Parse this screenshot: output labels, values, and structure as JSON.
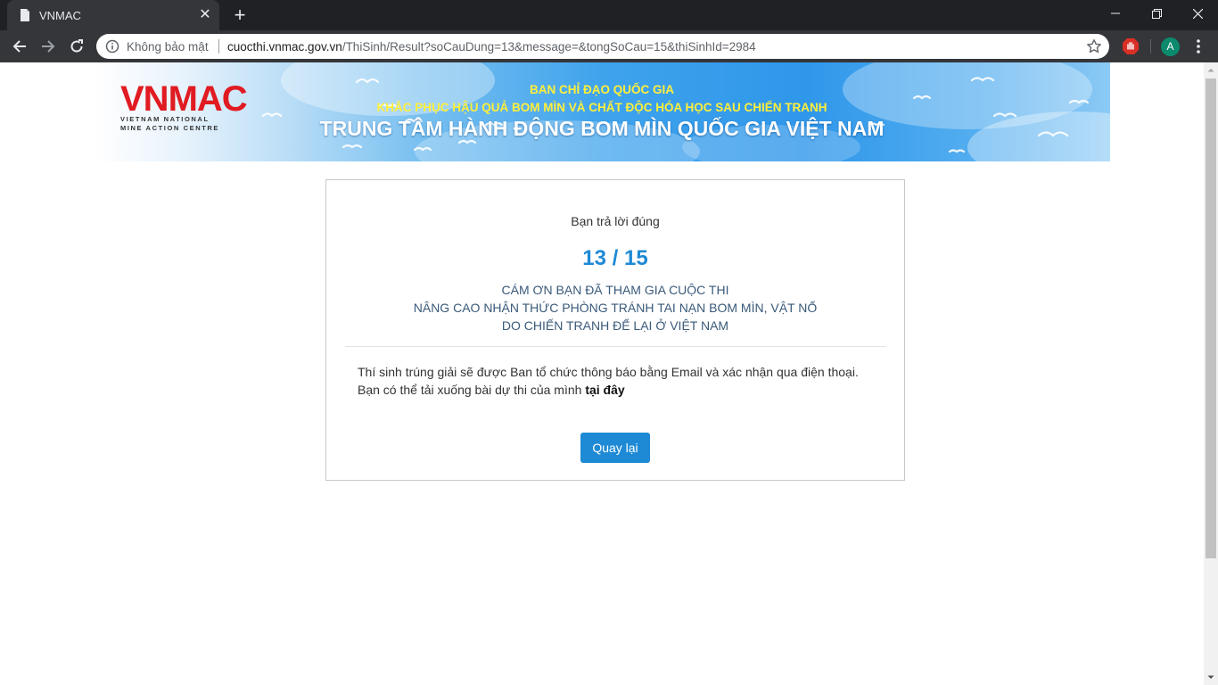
{
  "browser": {
    "tab_title": "VNMAC",
    "security_label": "Không bảo mật",
    "url_host": "cuocthi.vnmac.gov.vn",
    "url_path": "/ThiSinh/Result?soCauDung=13&message=&tongSoCau=15&thiSinhId=2984",
    "avatar_letter": "A"
  },
  "banner": {
    "logo_text": "VNMAC",
    "logo_sub_line1": "VIETNAM NATIONAL",
    "logo_sub_line2": "MINE ACTION CENTRE",
    "line1": "BAN CHỈ ĐẠO QUỐC GIA",
    "line2": "KHẮC PHỤC HẬU QUẢ BOM MÌN VÀ CHẤT ĐỘC HÓA HỌC SAU CHIẾN TRANH",
    "line3": "TRUNG TÂM HÀNH ĐỘNG BOM MÌN QUỐC GIA VIỆT NAM"
  },
  "result": {
    "answered_label": "Bạn trả lời đúng",
    "score": "13 / 15",
    "thanks_line1": "CÁM ƠN BẠN ĐÃ THAM GIA CUỘC THI",
    "thanks_line2": "NÂNG CAO NHẬN THỨC PHÒNG TRÁNH TAI NẠN BOM MÌN, VẬT NỔ",
    "thanks_line3": "DO CHIẾN TRANH ĐỂ LẠI Ở VIỆT NAM",
    "notice_line1": "Thí sinh trúng giải sẽ được Ban tổ chức thông báo bằng Email và xác nhận qua điện thoại.",
    "notice_line2_prefix": "Bạn có thể tải xuống bài dự thi của mình ",
    "download_link": "tại đây",
    "back_button": "Quay lại"
  },
  "colors": {
    "accent": "#1e8ad6",
    "logo_red": "#e11b22",
    "banner_yellow": "#ffef3a"
  }
}
